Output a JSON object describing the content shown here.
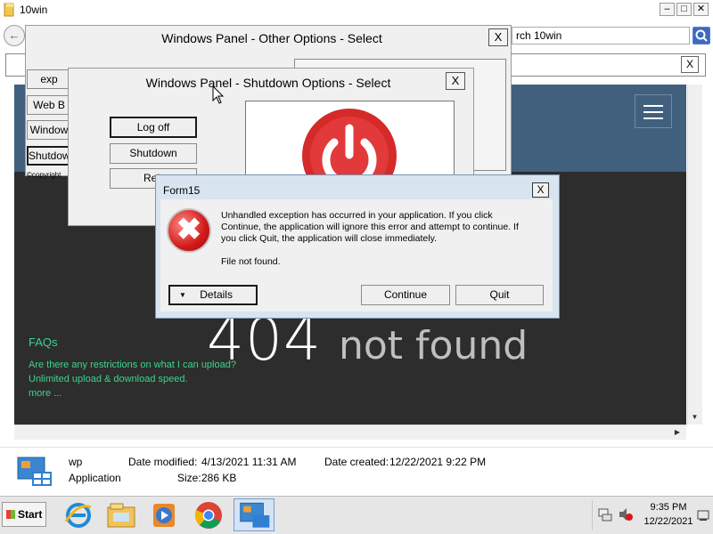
{
  "explorer": {
    "title": "10win",
    "search_value": "rch 10win",
    "window_buttons": {
      "minimize": "–",
      "maximize": "□",
      "close": "✕"
    },
    "addressbar_close": "X"
  },
  "website": {
    "big_404": "404",
    "not_found": "not found",
    "faqs_title": "FAQs",
    "faq_lines": [
      "Are there any restrictions on what I can upload?",
      "Unlimited upload & download speed.",
      "more ..."
    ]
  },
  "other_options_dialog": {
    "title": "Windows Panel - Other Options - Select",
    "close": "X",
    "buttons": [
      "exp",
      "Web B",
      "Window",
      "Shutdow"
    ],
    "copyright": "©copyright"
  },
  "shutdown_dialog": {
    "title": "Windows Panel - Shutdown Options - Select",
    "close": "X",
    "buttons": [
      "Log off",
      "Shutdown",
      "Reb"
    ]
  },
  "form15": {
    "title": "Form15",
    "close": "X",
    "message": "Unhandled exception has occurred in your application. If you click Continue, the application will ignore this error and attempt to continue. If you click Quit, the application will close immediately.",
    "file_message": "File not found.",
    "details_button": "Details",
    "details_arrow": "▼",
    "continue_button": "Continue",
    "quit_button": "Quit",
    "icon": "error-x-icon"
  },
  "details_pane": {
    "name": "wp",
    "type": "Application",
    "date_modified_label": "Date modified:",
    "date_modified": "4/13/2021 11:31 AM",
    "date_created_label": "Date created:",
    "date_created": "12/22/2021 9:22 PM",
    "size_label": "Size:",
    "size": "286 KB"
  },
  "taskbar": {
    "start_label": "Start",
    "clock_time": "9:35 PM",
    "clock_date": "12/22/2021",
    "apps": [
      "ie-icon",
      "explorer-icon",
      "media-player-icon",
      "chrome-icon",
      "app-icon"
    ]
  },
  "colors": {
    "web_header": "#40607e",
    "web_bg": "#2d2d2d",
    "faq_green": "#3bd48e",
    "error_red": "#d11a1a",
    "power_red": "#d42a2a"
  }
}
